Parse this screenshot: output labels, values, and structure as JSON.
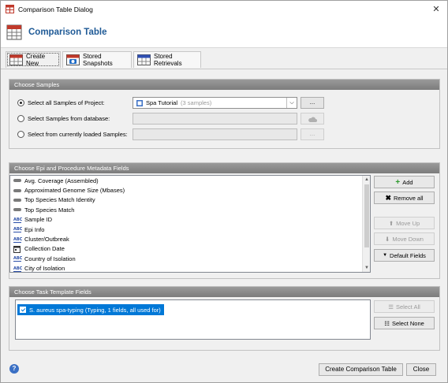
{
  "window": {
    "title": "Comparison Table Dialog",
    "close_glyph": "✕"
  },
  "header": {
    "title": "Comparison Table"
  },
  "tabs": [
    {
      "label": "Create New",
      "icon": "table-red-icon"
    },
    {
      "label": "Stored Snapshots",
      "icon": "camera-table-icon"
    },
    {
      "label": "Stored Retrievals",
      "icon": "table-blue-icon"
    }
  ],
  "choose_samples": {
    "heading": "Choose Samples",
    "option_project": "Select all Samples of Project:",
    "option_database": "Select Samples from database:",
    "option_loaded": "Select from currently loaded Samples:",
    "project_value": "Spa Tutorial",
    "project_count": "(3 samples)",
    "browse_label": "...",
    "loaded_browse_label": "..."
  },
  "metadata": {
    "heading": "Choose Epi and Procedure Metadata Fields",
    "items": [
      {
        "label": "Avg. Coverage (Assembled)",
        "icon": "numeric-pill-icon"
      },
      {
        "label": "Approximated Genome Size (Mbases)",
        "icon": "numeric-pill-icon"
      },
      {
        "label": "Top Species Match Identity",
        "icon": "numeric-pill-icon"
      },
      {
        "label": "Top Species Match",
        "icon": "numeric-pill-icon"
      },
      {
        "label": "Sample ID",
        "icon": "text-abc-icon"
      },
      {
        "label": "Epi Info",
        "icon": "text-abc-icon"
      },
      {
        "label": "Cluster/Outbreak",
        "icon": "text-abc-icon"
      },
      {
        "label": "Collection Date",
        "icon": "calendar-icon"
      },
      {
        "label": "Country of Isolation",
        "icon": "text-abc-icon"
      },
      {
        "label": "City of Isolation",
        "icon": "text-abc-icon"
      }
    ],
    "buttons": {
      "add": "Add",
      "remove_all": "Remove all",
      "move_up": "Move Up",
      "move_down": "Move Down",
      "default_fields": "Default Fields"
    }
  },
  "task_template": {
    "heading": "Choose Task Template Fields",
    "item": "S. aureus spa-typing (Typing, 1 fields, all used for)",
    "select_all": "Select All",
    "select_none": "Select None"
  },
  "footer": {
    "create": "Create Comparison Table",
    "close": "Close",
    "help_glyph": "?"
  }
}
